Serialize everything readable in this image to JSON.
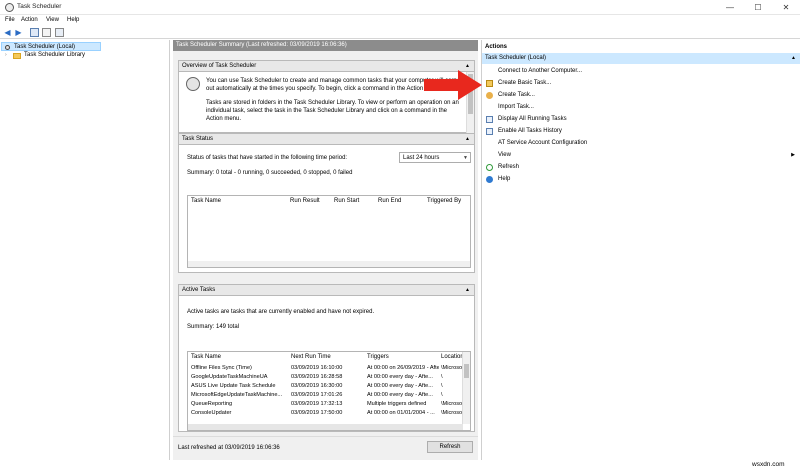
{
  "window": {
    "title": "Task Scheduler",
    "controls": [
      "—",
      "☐",
      "✕"
    ]
  },
  "menu": [
    "File",
    "Action",
    "View",
    "Help"
  ],
  "tree": {
    "root": "Task Scheduler (Local)",
    "library": "Task Scheduler Library"
  },
  "center": {
    "summary_header": "Task Scheduler Summary (Last refreshed: 03/09/2019 16:06:36)",
    "overview": {
      "header": "Overview of Task Scheduler",
      "para1": "You can use Task Scheduler to create and manage common tasks that your computer will carry out automatically at the times you specify. To begin, click a command in the Action menu.",
      "para2": "Tasks are stored in folders in the Task Scheduler Library. To view or perform an operation on an individual task, select the task in the Task Scheduler Library and click on a command in the Action menu."
    },
    "task_status": {
      "header": "Task Status",
      "label": "Status of tasks that have started in the following time period:",
      "period": "Last 24 hours",
      "summary": "Summary: 0 total - 0 running, 0 succeeded, 0 stopped, 0 failed",
      "columns": [
        "Task Name",
        "Run Result",
        "Run Start",
        "Run End",
        "Triggered By"
      ]
    },
    "active_tasks": {
      "header": "Active Tasks",
      "description": "Active tasks are tasks that are currently enabled and have not expired.",
      "summary": "Summary: 149 total",
      "columns": [
        "Task Name",
        "Next Run Time",
        "Triggers",
        "Location"
      ],
      "rows": [
        [
          "Offline Files Sync (Time)",
          "03/09/2019 16:10:00",
          "At 00:00 on 26/09/2019 - Afte...",
          "\\Microsof"
        ],
        [
          "GoogleUpdateTaskMachineUA",
          "03/09/2019 16:28:58",
          "At 00:00 every day - Afte...",
          "\\"
        ],
        [
          "ASUS Live Update Task Schedule",
          "03/09/2019 16:30:00",
          "At 00:00 every day - Afte...",
          "\\"
        ],
        [
          "MicrosoftEdgeUpdateTaskMachine...",
          "03/09/2019 17:01:26",
          "At 00:00 every day - Afte...",
          "\\"
        ],
        [
          "QueueReporting",
          "03/09/2019 17:32:13",
          "Multiple triggers defined",
          "\\Microsof"
        ],
        [
          "ConsoleUpdater",
          "03/09/2019 17:50:00",
          "At 00:00 on 01/01/2004 - ...",
          "\\Microsof"
        ]
      ]
    },
    "last_refreshed": "Last refreshed at 03/09/2019 16:06:36",
    "refresh_label": "Refresh"
  },
  "actions": {
    "header": "Actions",
    "subheader": "Task Scheduler (Local)",
    "items": [
      "Connect to Another Computer...",
      "Create Basic Task...",
      "Create Task...",
      "Import Task...",
      "Display All Running Tasks",
      "Enable All Tasks History",
      "AT Service Account Configuration",
      "View",
      "Refresh",
      "Help"
    ]
  },
  "watermark": "wsxdn.com",
  "colors": {
    "selection": "#cce8ff",
    "arrow": "#e8281e",
    "summary_header": "#8c8c8c"
  }
}
